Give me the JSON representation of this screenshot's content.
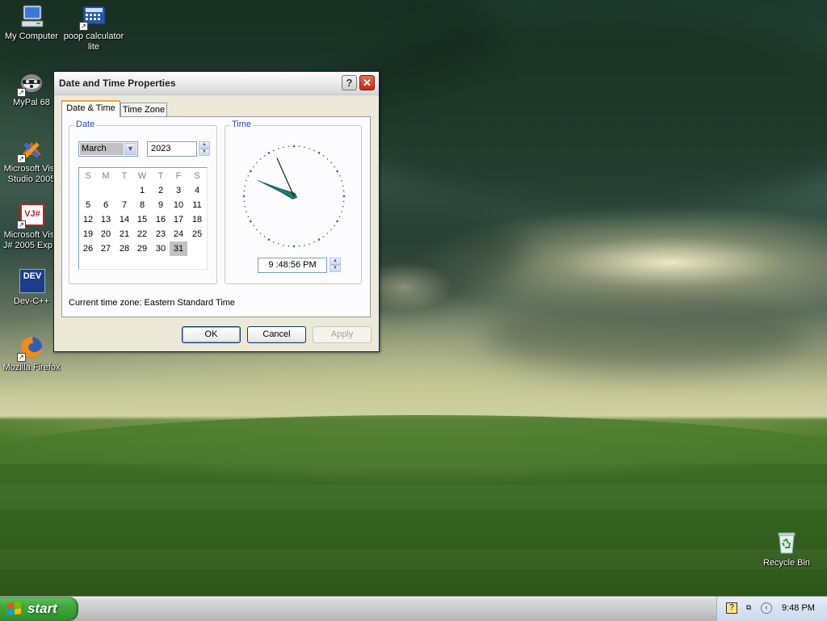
{
  "desktop": {
    "icons": [
      {
        "label": "My Computer"
      },
      {
        "label": "poop calculator lite"
      },
      {
        "label": "MyPal 68"
      },
      {
        "label": "Microsoft Visual Studio 2005",
        "shown": "Microsoft Visu\nStudio 2005"
      },
      {
        "label": "Microsoft Visual J# 2005 Express",
        "shown": "Microsoft Visu\nJ# 2005 Exp..."
      },
      {
        "label": "Dev-C++"
      },
      {
        "label": "Mozilla Firefox"
      },
      {
        "label": "Recycle Bin"
      }
    ],
    "devcpp_badge": "DEV",
    "vj_badge": "VJ#"
  },
  "dialog": {
    "title": "Date and Time Properties",
    "help_glyph": "?",
    "close_glyph": "✕",
    "tabs": [
      {
        "label": "Date & Time",
        "active": true
      },
      {
        "label": "Time Zone",
        "active": false
      }
    ],
    "date_group": {
      "label": "Date",
      "month": "March",
      "year": "2023",
      "weekdays": [
        "S",
        "M",
        "T",
        "W",
        "T",
        "F",
        "S"
      ],
      "first_weekday_index": 3,
      "days_in_month": 31,
      "selected_day": 31
    },
    "time_group": {
      "label": "Time",
      "time": "9 :48:56 PM",
      "clock": {
        "hours": 9,
        "minutes": 48,
        "seconds": 56
      }
    },
    "current_tz_label": "Current time zone:  Eastern Standard Time",
    "buttons": {
      "ok": "OK",
      "cancel": "Cancel",
      "apply": "Apply"
    }
  },
  "taskbar": {
    "start_label": "start",
    "clock": "9:48 PM"
  },
  "colors": {
    "accent_tab": "#f1a83a",
    "clock_hands": "#1f7a72",
    "group_label": "#1c4bb0",
    "start_green": "#3da93a"
  }
}
